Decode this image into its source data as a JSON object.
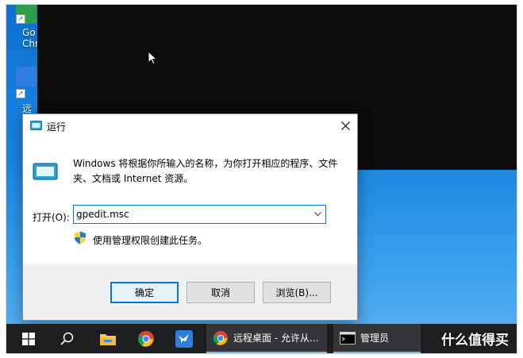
{
  "desktop": {
    "icons": [
      {
        "name": "google-chrome-shortcut",
        "label_lines": [
          "Go",
          "Chr"
        ]
      },
      {
        "name": "remote-desktop-shortcut",
        "label_lines": [
          "远"
        ]
      }
    ]
  },
  "dialog": {
    "title": "运行",
    "description": "Windows 将根据你所输入的名称，为你打开相应的程序、文件夹、文档或 Internet 资源。",
    "open_label": "打开(O):",
    "open_value": "gpedit.msc",
    "admin_note": "使用管理权限创建此任务。",
    "buttons": {
      "ok": "确定",
      "cancel": "取消",
      "browse": "浏览(B)..."
    }
  },
  "taskbar": {
    "apps": [
      {
        "label": "远程桌面 - 允许从..."
      },
      {
        "label": "管理员"
      }
    ]
  },
  "watermark": "什么值得买",
  "colors": {
    "accent": "#0078d7",
    "desktop_blue": "#1a86e0",
    "taskbar": "#1d1e20",
    "dark_window": "#0b0b0b"
  }
}
